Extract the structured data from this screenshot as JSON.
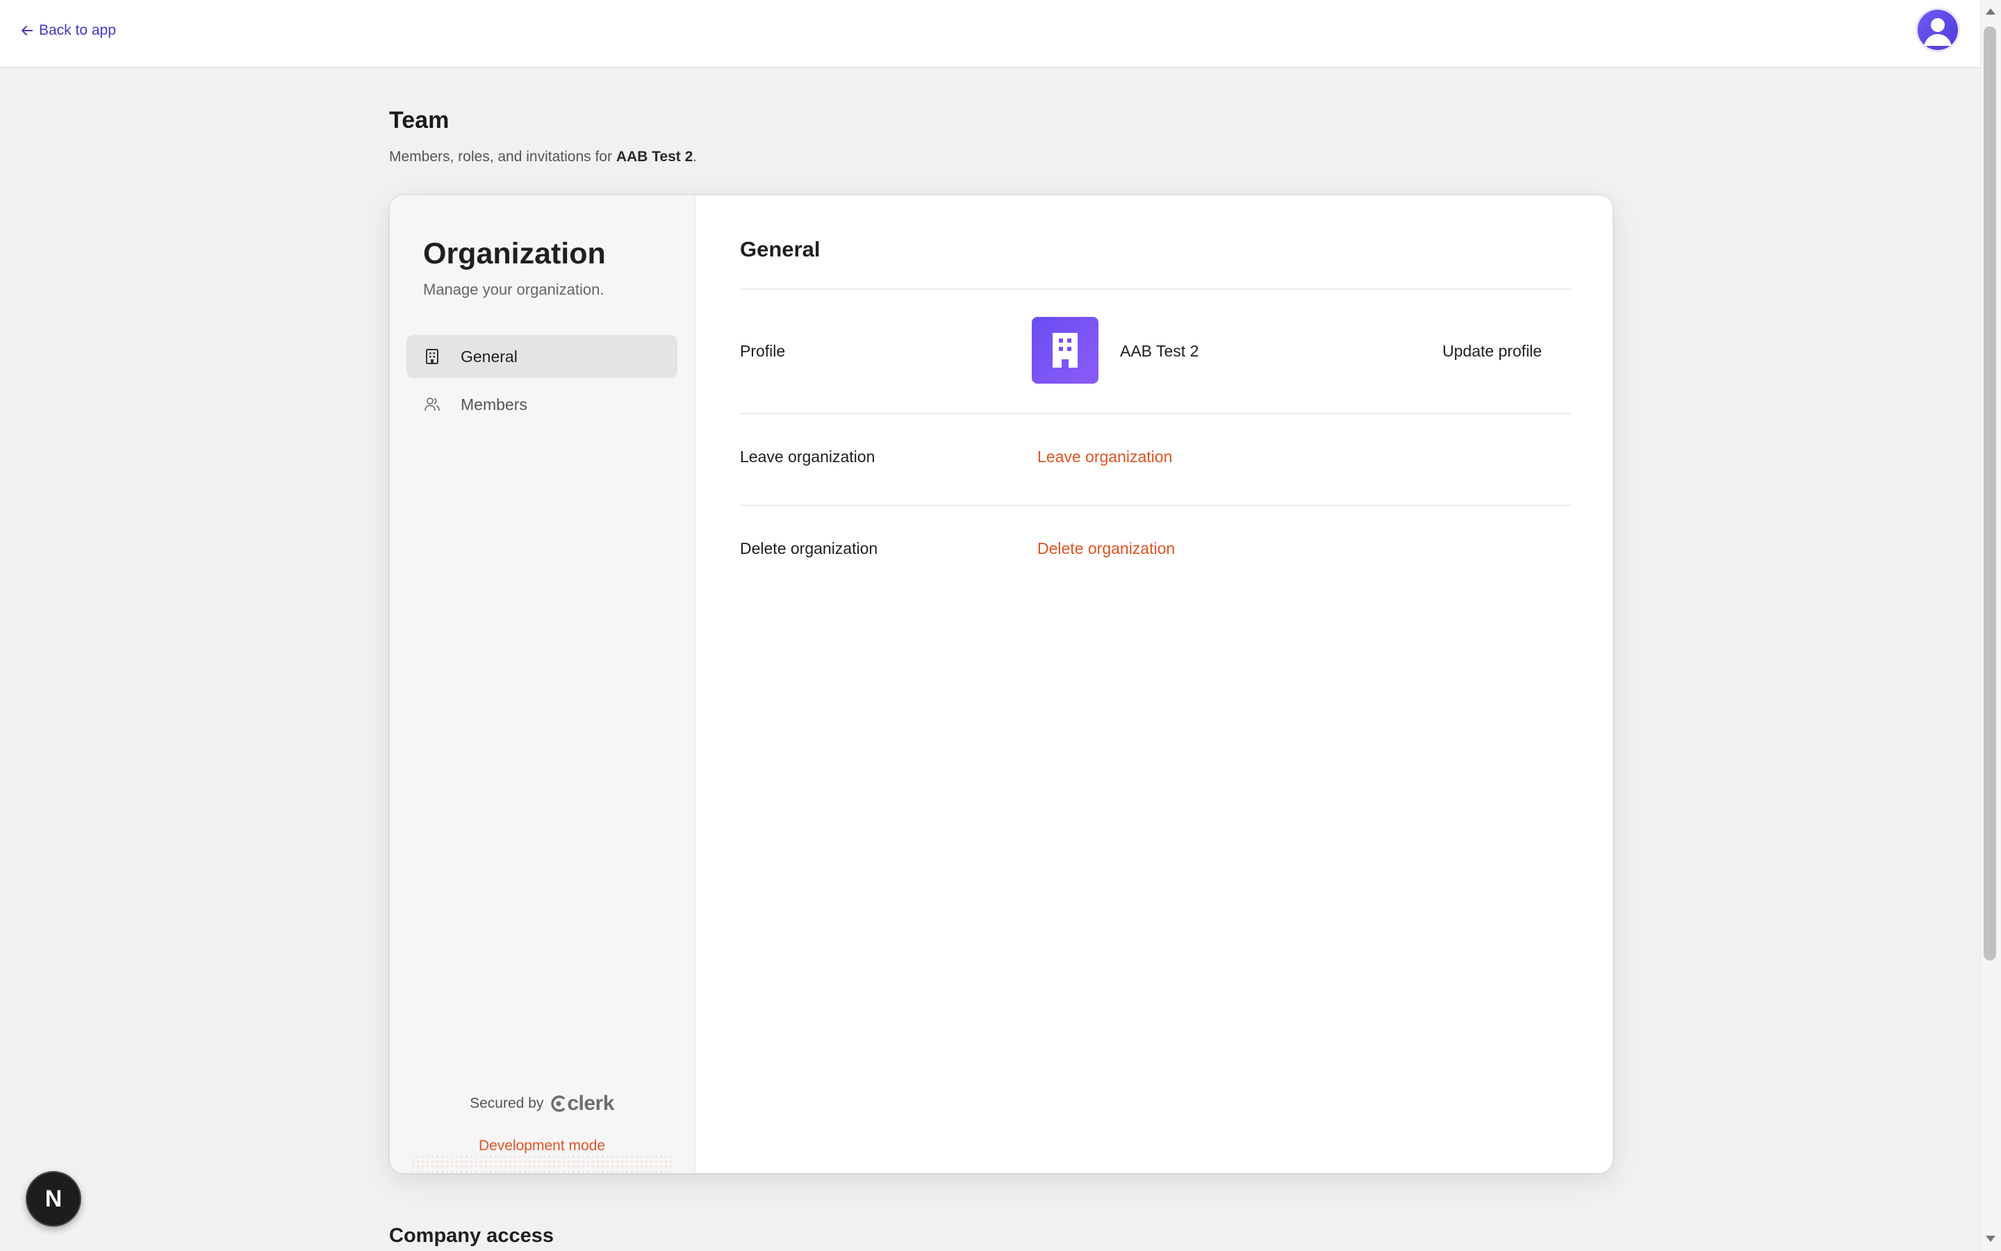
{
  "topbar": {
    "back_label": "Back to app"
  },
  "page": {
    "title": "Team",
    "subtitle_prefix": "Members, roles, and invitations for ",
    "subtitle_org": "AAB Test 2",
    "subtitle_suffix": "."
  },
  "sidebar": {
    "title": "Organization",
    "subtitle": "Manage your organization.",
    "items": [
      {
        "label": "General",
        "icon": "building-icon",
        "active": true
      },
      {
        "label": "Members",
        "icon": "users-icon",
        "active": false
      }
    ],
    "secured_by": "Secured by",
    "brand": "clerk",
    "dev_mode": "Development mode"
  },
  "main": {
    "title": "General",
    "profile": {
      "label": "Profile",
      "org_name": "AAB Test 2",
      "action": "Update profile"
    },
    "leave": {
      "label": "Leave organization",
      "action": "Leave organization"
    },
    "delete": {
      "label": "Delete organization",
      "action": "Delete organization"
    }
  },
  "next_section": {
    "title": "Company access"
  },
  "dev_badge": {
    "letter": "N"
  },
  "colors": {
    "accent": "#4338ca",
    "danger": "#e1531f",
    "logo": "#7c4dff"
  }
}
